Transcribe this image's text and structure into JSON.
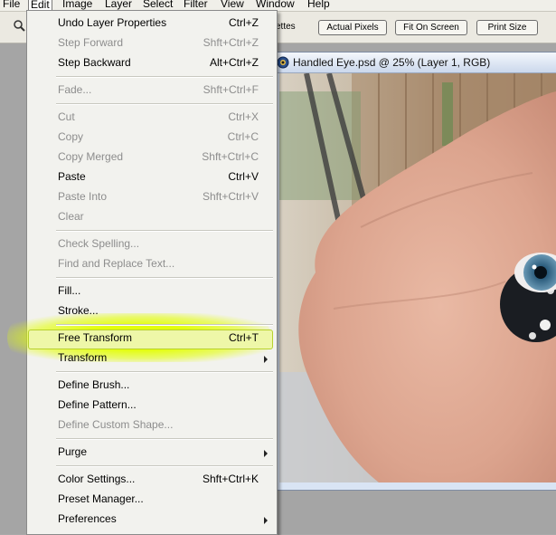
{
  "menubar": {
    "items": [
      "File",
      "Edit",
      "Image",
      "Layer",
      "Select",
      "Filter",
      "View",
      "Window",
      "Help"
    ]
  },
  "optionsbar": {
    "palettes_label": "ettes",
    "actual_pixels": "Actual Pixels",
    "fit_on_screen": "Fit On Screen",
    "print_size": "Print Size"
  },
  "document": {
    "title": "Handled Eye.psd @ 25% (Layer 1, RGB)"
  },
  "edit_menu": {
    "items": [
      {
        "label": "Undo Layer Properties",
        "shortcut": "Ctrl+Z",
        "enabled": true
      },
      {
        "label": "Step Forward",
        "shortcut": "Shft+Ctrl+Z",
        "enabled": false
      },
      {
        "label": "Step Backward",
        "shortcut": "Alt+Ctrl+Z",
        "enabled": true
      },
      {
        "label": "Fade...",
        "shortcut": "Shft+Ctrl+F",
        "enabled": false
      },
      {
        "label": "Cut",
        "shortcut": "Ctrl+X",
        "enabled": false
      },
      {
        "label": "Copy",
        "shortcut": "Ctrl+C",
        "enabled": false
      },
      {
        "label": "Copy Merged",
        "shortcut": "Shft+Ctrl+C",
        "enabled": false
      },
      {
        "label": "Paste",
        "shortcut": "Ctrl+V",
        "enabled": true
      },
      {
        "label": "Paste Into",
        "shortcut": "Shft+Ctrl+V",
        "enabled": false
      },
      {
        "label": "Clear",
        "shortcut": "",
        "enabled": false
      },
      {
        "label": "Check Spelling...",
        "shortcut": "",
        "enabled": false
      },
      {
        "label": "Find and Replace Text...",
        "shortcut": "",
        "enabled": false
      },
      {
        "label": "Fill...",
        "shortcut": "",
        "enabled": true
      },
      {
        "label": "Stroke...",
        "shortcut": "",
        "enabled": true
      },
      {
        "label": "Free Transform",
        "shortcut": "Ctrl+T",
        "enabled": true,
        "highlighted": true
      },
      {
        "label": "Transform",
        "shortcut": "",
        "enabled": true,
        "submenu": true
      },
      {
        "label": "Define Brush...",
        "shortcut": "",
        "enabled": true
      },
      {
        "label": "Define Pattern...",
        "shortcut": "",
        "enabled": true
      },
      {
        "label": "Define Custom Shape...",
        "shortcut": "",
        "enabled": false
      },
      {
        "label": "Purge",
        "shortcut": "",
        "enabled": true,
        "submenu": true
      },
      {
        "label": "Color Settings...",
        "shortcut": "Shft+Ctrl+K",
        "enabled": true
      },
      {
        "label": "Preset Manager...",
        "shortcut": "",
        "enabled": true
      },
      {
        "label": "Preferences",
        "shortcut": "",
        "enabled": true,
        "submenu": true
      }
    ]
  },
  "colors": {
    "highlight": "#e2ff00",
    "disabled_text": "#8d8d8d"
  }
}
